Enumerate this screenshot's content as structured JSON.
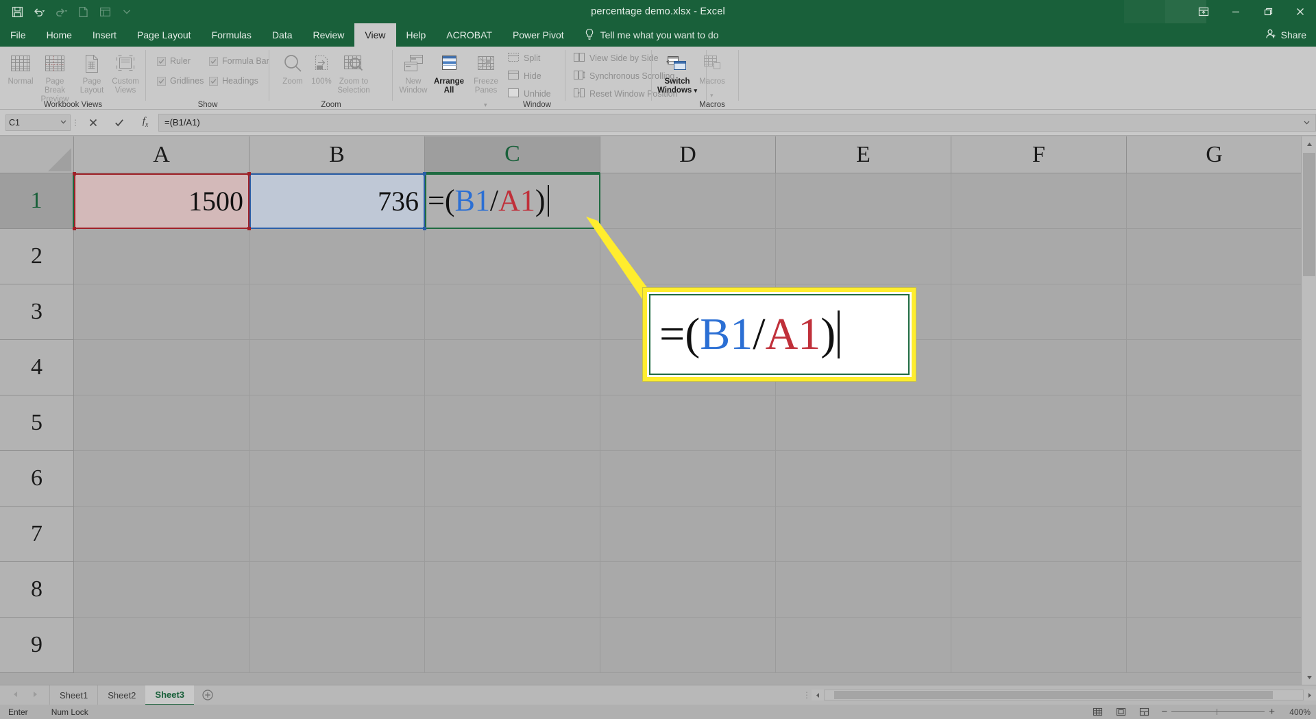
{
  "window": {
    "title": "percentage demo.xlsx  -  Excel",
    "quick_access": [
      "save-icon",
      "undo-icon",
      "redo-icon",
      "new-icon",
      "print-preview-icon",
      "customize-qat-icon"
    ],
    "controls": [
      "ribbon-display-options",
      "minimize",
      "restore",
      "close"
    ],
    "share_label": "Share"
  },
  "ribbon": {
    "tabs": [
      {
        "label": "File"
      },
      {
        "label": "Home"
      },
      {
        "label": "Insert"
      },
      {
        "label": "Page Layout"
      },
      {
        "label": "Formulas"
      },
      {
        "label": "Data"
      },
      {
        "label": "Review"
      },
      {
        "label": "View",
        "active": true
      },
      {
        "label": "Help"
      },
      {
        "label": "ACROBAT"
      },
      {
        "label": "Power Pivot"
      }
    ],
    "tellme": "Tell me what you want to do",
    "groups": [
      {
        "name": "Workbook Views",
        "label": "Workbook Views",
        "buttons": [
          {
            "label": "Normal",
            "icon": "normal-view-icon",
            "enabled": false
          },
          {
            "label": "Page Break Preview",
            "icon": "page-break-preview-icon",
            "enabled": false
          },
          {
            "label": "Page Layout",
            "icon": "page-layout-icon",
            "enabled": false
          },
          {
            "label": "Custom Views",
            "icon": "custom-views-icon",
            "enabled": false
          }
        ]
      },
      {
        "name": "Show",
        "label": "Show",
        "checks": [
          {
            "label": "Ruler",
            "checked": true
          },
          {
            "label": "Formula Bar",
            "checked": true
          },
          {
            "label": "Gridlines",
            "checked": true
          },
          {
            "label": "Headings",
            "checked": true
          }
        ]
      },
      {
        "name": "Zoom",
        "label": "Zoom",
        "buttons": [
          {
            "label": "Zoom",
            "icon": "magnifier-icon",
            "enabled": false
          },
          {
            "label": "100%",
            "icon": "zoom-100-icon",
            "enabled": false
          },
          {
            "label": "Zoom to Selection",
            "icon": "zoom-to-selection-icon",
            "enabled": false
          }
        ]
      },
      {
        "name": "Window",
        "label": "Window",
        "buttons": [
          {
            "label": "New Window",
            "icon": "new-window-icon",
            "enabled": false
          },
          {
            "label": "Arrange All",
            "icon": "arrange-all-icon",
            "enabled": true
          },
          {
            "label": "Freeze Panes",
            "icon": "freeze-panes-icon",
            "enabled": false
          }
        ],
        "stacked": [
          {
            "label": "Split",
            "icon": "split-icon",
            "enabled": false
          },
          {
            "label": "Hide",
            "icon": "hide-icon",
            "enabled": false
          },
          {
            "label": "Unhide",
            "icon": "unhide-icon",
            "enabled": false
          },
          {
            "label": "View Side by Side",
            "icon": "side-by-side-icon",
            "enabled": false
          },
          {
            "label": "Synchronous Scrolling",
            "icon": "sync-scroll-icon",
            "enabled": false
          },
          {
            "label": "Reset Window Position",
            "icon": "reset-window-position-icon",
            "enabled": false
          }
        ],
        "switch_windows": {
          "label_line1": "Switch",
          "label_line2": "Windows",
          "enabled": true
        }
      },
      {
        "name": "Macros",
        "label": "Macros",
        "buttons": [
          {
            "label": "Macros",
            "icon": "macros-icon",
            "enabled": false
          }
        ]
      }
    ]
  },
  "formula_bar": {
    "name_box": "C1",
    "cancel_icon": "cancel-icon",
    "enter_icon": "confirm-check-icon",
    "fx_icon": "insert-function-icon",
    "value": "=(B1/A1)",
    "expand_icon": "expand-formula-bar-icon"
  },
  "grid": {
    "columns": [
      "A",
      "B",
      "C",
      "D",
      "E",
      "F",
      "G"
    ],
    "selected_column": "C",
    "rows": [
      "1",
      "2",
      "3",
      "4",
      "5",
      "6",
      "7",
      "8",
      "9"
    ],
    "selected_row": "1",
    "cells": {
      "A1": "1500",
      "B1": "736",
      "C1_formula_parts": [
        {
          "text": "=(",
          "role": "operator"
        },
        {
          "text": "B1",
          "role": "ref-blue"
        },
        {
          "text": "/",
          "role": "operator"
        },
        {
          "text": "A1",
          "role": "ref-red"
        },
        {
          "text": ")",
          "role": "operator"
        }
      ]
    },
    "colors": {
      "ref_blue": "#2b6fd4",
      "ref_red": "#c0303a",
      "edit_green": "#1f6b41",
      "a1_fill": "#d3b9b9",
      "b1_fill": "#bfc8d6"
    }
  },
  "callout": {
    "border_color": "#ffed2e",
    "formula_parts": [
      {
        "text": "=(",
        "role": "operator"
      },
      {
        "text": "B1",
        "role": "ref-blue"
      },
      {
        "text": "/",
        "role": "operator"
      },
      {
        "text": "A1",
        "role": "ref-red"
      },
      {
        "text": ")",
        "role": "operator"
      }
    ]
  },
  "sheet_tabs": {
    "tabs": [
      {
        "label": "Sheet1",
        "active": false
      },
      {
        "label": "Sheet2",
        "active": false
      },
      {
        "label": "Sheet3",
        "active": true
      }
    ],
    "add_sheet_icon": "add-sheet-icon"
  },
  "status_bar": {
    "mode": "Enter",
    "num_lock": "Num Lock",
    "view_buttons": [
      "normal-view-icon",
      "page-layout-view-icon",
      "page-break-view-icon"
    ],
    "zoom_percent": "400%"
  }
}
